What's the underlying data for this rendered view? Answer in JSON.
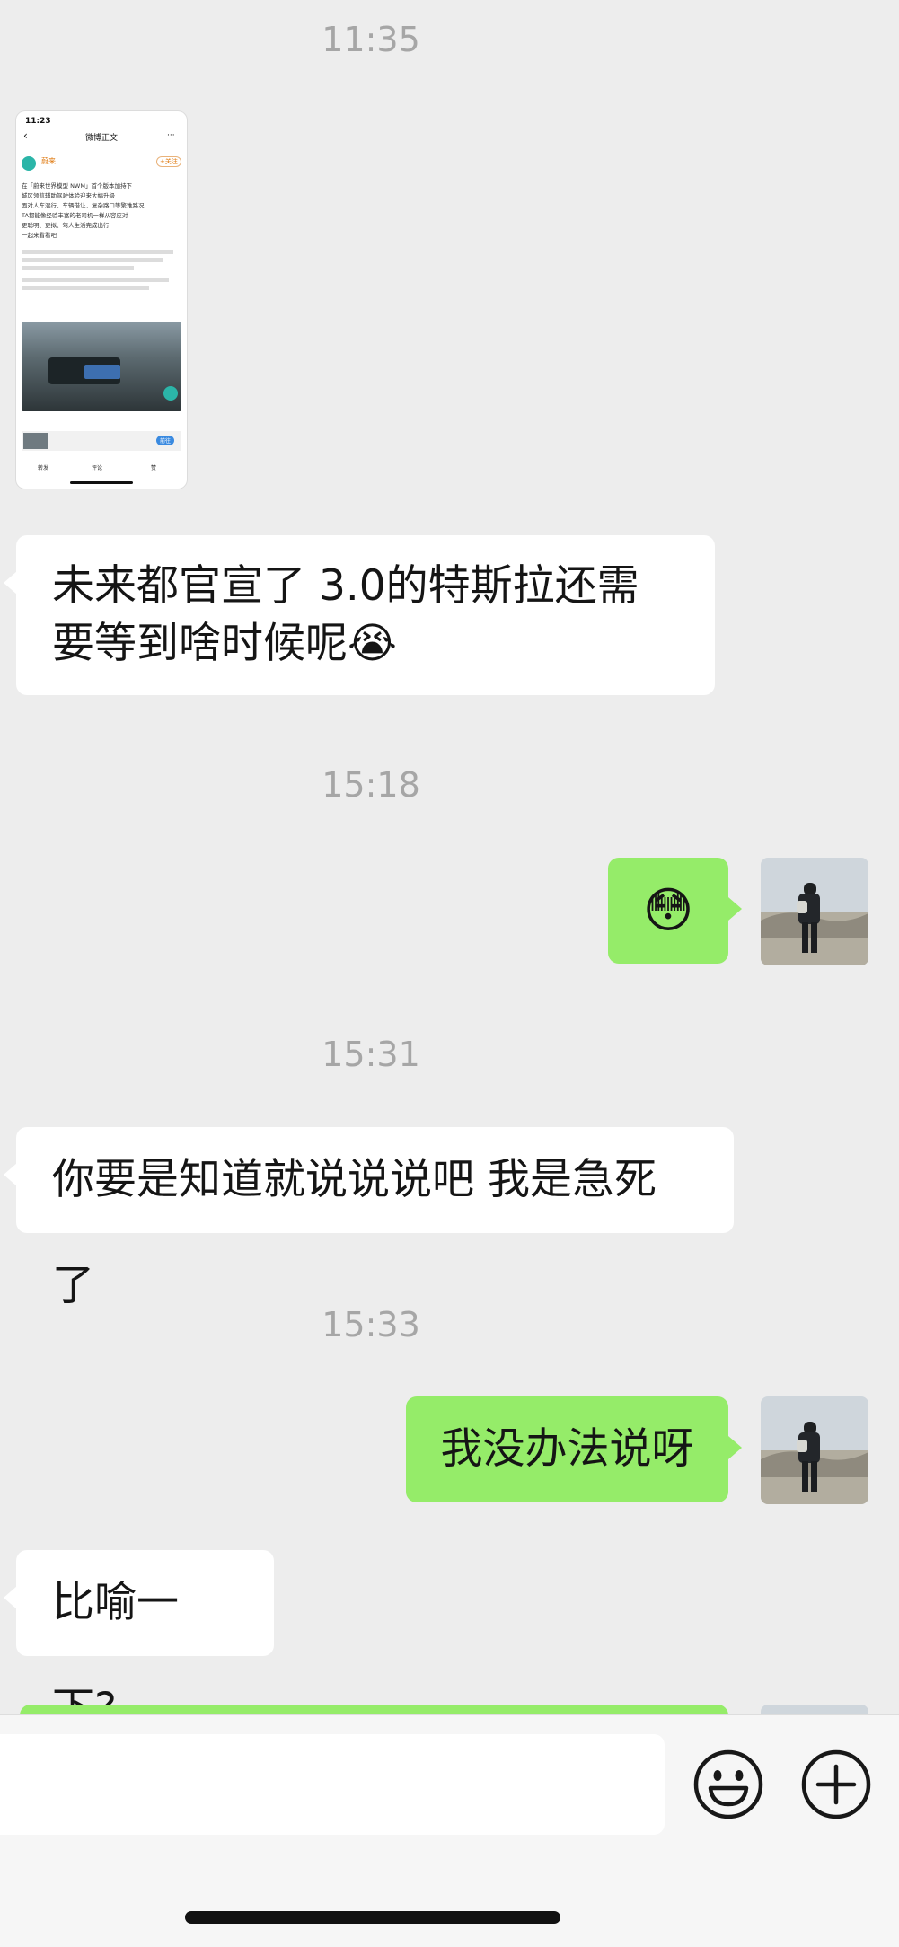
{
  "chat": {
    "time_1": "11:35",
    "time_2": "15:18",
    "time_3": "15:31",
    "time_4": "15:33",
    "msg_1_text": "未来都官宣了 3.0的特斯拉还需要等到啥时候呢",
    "msg_1_emoji": "😭",
    "msg_2_emoji": "😳",
    "msg_3": "你要是知道就说说说吧 我是急死了",
    "msg_4": "我没办法说呀",
    "msg_5": "比喻一下?"
  },
  "screenshot": {
    "status_time": "11:23",
    "page_title": "微博正文",
    "author": "蔚来",
    "follow_label": "+关注",
    "post_lines": [
      "在「蔚来世界模型 NWM」首个版本加持下",
      "城区领航辅助驾驶体验迎来大幅升级",
      "面对人车混行、车辆借让、复杂路口等繁难路况",
      "TA都能像经验丰富的老司机一样从容应对",
      "更聪明、更拟、驾人生活完成出行",
      "一起来看看吧"
    ],
    "bottom_actions": [
      "转发",
      "评论",
      "赞"
    ],
    "action_button": "前往"
  },
  "icons": {
    "emoji_button": "smiley-face-icon",
    "more_button": "plus-circle-icon"
  },
  "colors": {
    "background": "#ededed",
    "outgoing_bubble": "#95ec69",
    "incoming_bubble": "#ffffff",
    "timestamp": "#a6a6a6"
  }
}
